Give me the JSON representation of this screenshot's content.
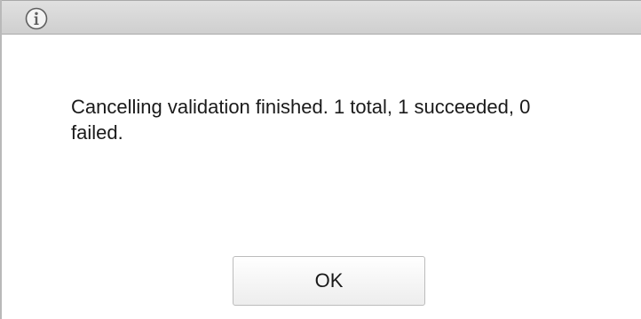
{
  "dialog": {
    "icon": "info-icon",
    "message": "Cancelling validation finished. 1 total, 1 succeeded, 0 failed.",
    "ok_label": "OK"
  },
  "colors": {
    "titlebar": "#d6d6d6",
    "border": "#b9b9b9",
    "text": "#1a1a1a"
  }
}
